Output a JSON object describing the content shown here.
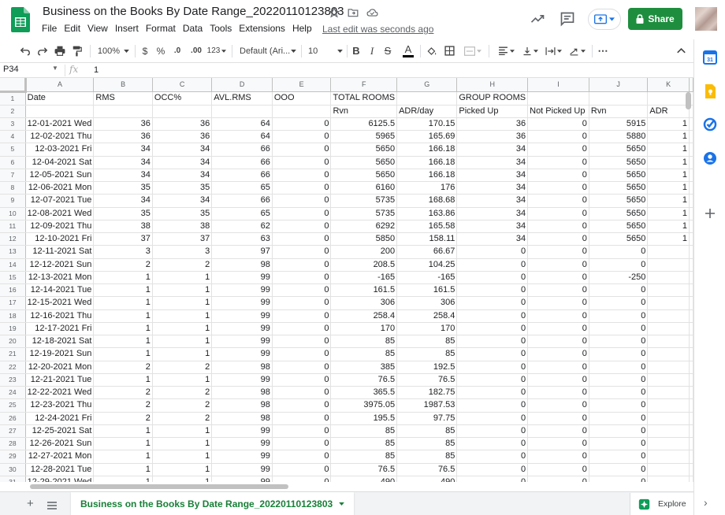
{
  "document": {
    "title": "Business on the Books By Date Range_20220110123803",
    "last_edit": "Last edit was seconds ago"
  },
  "menu": [
    "File",
    "Edit",
    "View",
    "Insert",
    "Format",
    "Data",
    "Tools",
    "Extensions",
    "Help"
  ],
  "share": {
    "label": "Share"
  },
  "toolbar": {
    "zoom": "100%",
    "currency": "$",
    "percent": "%",
    "decrease_decimal": ".0",
    "increase_decimal": ".00",
    "more_formats": "123",
    "font": "Default (Ari...",
    "font_size": "10",
    "bold": "B",
    "italic": "I",
    "strikethrough": "S",
    "text_color": "A",
    "more": "⋯"
  },
  "formula_bar": {
    "cell_ref": "P34",
    "fx": "fx",
    "value": "1"
  },
  "grid": {
    "columns": [
      "A",
      "B",
      "C",
      "D",
      "E",
      "F",
      "G",
      "H",
      "I",
      "J",
      "K"
    ],
    "header_row1": [
      "Date",
      "RMS",
      "OCC%",
      "AVL.RMS",
      "OOO",
      "TOTAL ROOMS",
      "",
      "GROUP ROOMS",
      "",
      "",
      ""
    ],
    "header_row2": [
      "",
      "",
      "",
      "",
      "",
      "Rvn",
      "ADR/day",
      "Picked Up",
      "Not Picked Up",
      "Rvn",
      "ADR"
    ],
    "rows": [
      [
        "12-01-2021 Wed",
        "36",
        "36",
        "64",
        "0",
        "6125.5",
        "170.15",
        "36",
        "0",
        "5915",
        "1"
      ],
      [
        "12-02-2021 Thu",
        "36",
        "36",
        "64",
        "0",
        "5965",
        "165.69",
        "36",
        "0",
        "5880",
        "1"
      ],
      [
        "12-03-2021 Fri",
        "34",
        "34",
        "66",
        "0",
        "5650",
        "166.18",
        "34",
        "0",
        "5650",
        "1"
      ],
      [
        "12-04-2021 Sat",
        "34",
        "34",
        "66",
        "0",
        "5650",
        "166.18",
        "34",
        "0",
        "5650",
        "1"
      ],
      [
        "12-05-2021 Sun",
        "34",
        "34",
        "66",
        "0",
        "5650",
        "166.18",
        "34",
        "0",
        "5650",
        "1"
      ],
      [
        "12-06-2021 Mon",
        "35",
        "35",
        "65",
        "0",
        "6160",
        "176",
        "34",
        "0",
        "5650",
        "1"
      ],
      [
        "12-07-2021 Tue",
        "34",
        "34",
        "66",
        "0",
        "5735",
        "168.68",
        "34",
        "0",
        "5650",
        "1"
      ],
      [
        "12-08-2021 Wed",
        "35",
        "35",
        "65",
        "0",
        "5735",
        "163.86",
        "34",
        "0",
        "5650",
        "1"
      ],
      [
        "12-09-2021 Thu",
        "38",
        "38",
        "62",
        "0",
        "6292",
        "165.58",
        "34",
        "0",
        "5650",
        "1"
      ],
      [
        "12-10-2021 Fri",
        "37",
        "37",
        "63",
        "0",
        "5850",
        "158.11",
        "34",
        "0",
        "5650",
        "1"
      ],
      [
        "12-11-2021 Sat",
        "3",
        "3",
        "97",
        "0",
        "200",
        "66.67",
        "0",
        "0",
        "0",
        ""
      ],
      [
        "12-12-2021 Sun",
        "2",
        "2",
        "98",
        "0",
        "208.5",
        "104.25",
        "0",
        "0",
        "0",
        ""
      ],
      [
        "12-13-2021 Mon",
        "1",
        "1",
        "99",
        "0",
        "-165",
        "-165",
        "0",
        "0",
        "-250",
        ""
      ],
      [
        "12-14-2021 Tue",
        "1",
        "1",
        "99",
        "0",
        "161.5",
        "161.5",
        "0",
        "0",
        "0",
        ""
      ],
      [
        "12-15-2021 Wed",
        "1",
        "1",
        "99",
        "0",
        "306",
        "306",
        "0",
        "0",
        "0",
        ""
      ],
      [
        "12-16-2021 Thu",
        "1",
        "1",
        "99",
        "0",
        "258.4",
        "258.4",
        "0",
        "0",
        "0",
        ""
      ],
      [
        "12-17-2021 Fri",
        "1",
        "1",
        "99",
        "0",
        "170",
        "170",
        "0",
        "0",
        "0",
        ""
      ],
      [
        "12-18-2021 Sat",
        "1",
        "1",
        "99",
        "0",
        "85",
        "85",
        "0",
        "0",
        "0",
        ""
      ],
      [
        "12-19-2021 Sun",
        "1",
        "1",
        "99",
        "0",
        "85",
        "85",
        "0",
        "0",
        "0",
        ""
      ],
      [
        "12-20-2021 Mon",
        "2",
        "2",
        "98",
        "0",
        "385",
        "192.5",
        "0",
        "0",
        "0",
        ""
      ],
      [
        "12-21-2021 Tue",
        "1",
        "1",
        "99",
        "0",
        "76.5",
        "76.5",
        "0",
        "0",
        "0",
        ""
      ],
      [
        "12-22-2021 Wed",
        "2",
        "2",
        "98",
        "0",
        "365.5",
        "182.75",
        "0",
        "0",
        "0",
        ""
      ],
      [
        "12-23-2021 Thu",
        "2",
        "2",
        "98",
        "0",
        "3975.05",
        "1987.53",
        "0",
        "0",
        "0",
        ""
      ],
      [
        "12-24-2021 Fri",
        "2",
        "2",
        "98",
        "0",
        "195.5",
        "97.75",
        "0",
        "0",
        "0",
        ""
      ],
      [
        "12-25-2021 Sat",
        "1",
        "1",
        "99",
        "0",
        "85",
        "85",
        "0",
        "0",
        "0",
        ""
      ],
      [
        "12-26-2021 Sun",
        "1",
        "1",
        "99",
        "0",
        "85",
        "85",
        "0",
        "0",
        "0",
        ""
      ],
      [
        "12-27-2021 Mon",
        "1",
        "1",
        "99",
        "0",
        "85",
        "85",
        "0",
        "0",
        "0",
        ""
      ],
      [
        "12-28-2021 Tue",
        "1",
        "1",
        "99",
        "0",
        "76.5",
        "76.5",
        "0",
        "0",
        "0",
        ""
      ],
      [
        "12-29-2021 Wed",
        "1",
        "1",
        "99",
        "0",
        "490",
        "490",
        "0",
        "0",
        "0",
        ""
      ]
    ]
  },
  "sheet_tab": {
    "name": "Business on the Books By Date Range_20220110123803"
  },
  "explore": {
    "label": "Explore"
  },
  "side_panel": {
    "icons": [
      "calendar-icon",
      "keep-icon",
      "tasks-icon",
      "contacts-icon",
      "add-addon-icon"
    ],
    "calendar_day": "31"
  },
  "colors": {
    "accent_green": "#1e8e3e",
    "sheet_tab_green": "#188038",
    "calendar_blue": "#1a73e8",
    "keep_yellow": "#fbbc04"
  }
}
